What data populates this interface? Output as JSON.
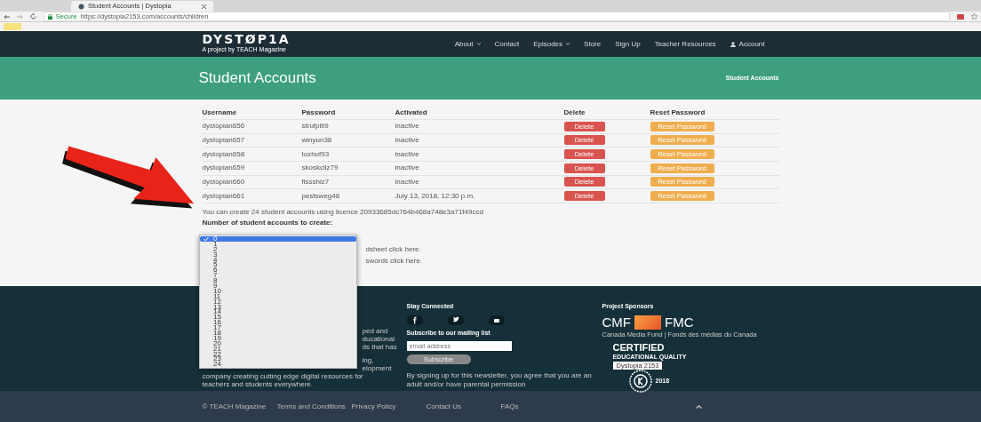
{
  "browser": {
    "tab_title": "Student Accounts | Dystopia",
    "secure_label": "Secure",
    "url": "https://dystopia2153.com/accounts/children"
  },
  "navbar": {
    "logo": "DYSTØP1A",
    "tagline": "A project by TEACH Magazine",
    "items": [
      {
        "label": "About",
        "kind": "dropdown"
      },
      {
        "label": "Contact",
        "kind": "link"
      },
      {
        "label": "Episodes",
        "kind": "dropdown"
      },
      {
        "label": "Store",
        "kind": "link"
      },
      {
        "label": "Sign Up",
        "kind": "link"
      },
      {
        "label": "Teacher Resources",
        "kind": "link"
      },
      {
        "label": "Account",
        "kind": "account"
      }
    ]
  },
  "header": {
    "title": "Student Accounts",
    "breadcrumb": "Student Accounts"
  },
  "table": {
    "columns": [
      "Username",
      "Password",
      "Activated",
      "Delete",
      "Reset Password"
    ],
    "rows": [
      {
        "username": "dystopian656",
        "password": "strufplit9",
        "activated": "inactive",
        "delete": "Delete",
        "reset": "Reset Password"
      },
      {
        "username": "dystopian657",
        "password": "winyun38",
        "activated": "inactive",
        "delete": "Delete",
        "reset": "Reset Password"
      },
      {
        "username": "dystopian658",
        "password": "tozhuf93",
        "activated": "inactive",
        "delete": "Delete",
        "reset": "Reset Password"
      },
      {
        "username": "dystopian659",
        "password": "skoskcliz79",
        "activated": "inactive",
        "delete": "Delete",
        "reset": "Reset Password"
      },
      {
        "username": "dystopian660",
        "password": "fissshiz7",
        "activated": "inactive",
        "delete": "Delete",
        "reset": "Reset Password"
      },
      {
        "username": "dystopian661",
        "password": "pestsweg48",
        "activated": "July 13, 2018, 12:30 p.m.",
        "delete": "Delete",
        "reset": "Reset Password"
      }
    ]
  },
  "licence_text": "You can create 24 student accounts using licence 20933685dc764b468a748e3a71f49ccd",
  "count_label": "Number of student accounts to create:",
  "dropdown_options": [
    {
      "label": "0",
      "selected": true
    },
    {
      "label": "1",
      "selected": false
    },
    {
      "label": "2",
      "selected": false
    },
    {
      "label": "3",
      "selected": false
    },
    {
      "label": "4",
      "selected": false
    },
    {
      "label": "5",
      "selected": false
    },
    {
      "label": "6",
      "selected": false
    },
    {
      "label": "7",
      "selected": false
    },
    {
      "label": "8",
      "selected": false
    },
    {
      "label": "9",
      "selected": false
    },
    {
      "label": "10",
      "selected": false
    },
    {
      "label": "11",
      "selected": false
    },
    {
      "label": "12",
      "selected": false
    },
    {
      "label": "13",
      "selected": false
    },
    {
      "label": "14",
      "selected": false
    },
    {
      "label": "15",
      "selected": false
    },
    {
      "label": "16",
      "selected": false
    },
    {
      "label": "17",
      "selected": false
    },
    {
      "label": "18",
      "selected": false
    },
    {
      "label": "19",
      "selected": false
    },
    {
      "label": "20",
      "selected": false
    },
    {
      "label": "21",
      "selected": false
    },
    {
      "label": "22",
      "selected": false
    },
    {
      "label": "23",
      "selected": false
    },
    {
      "label": "24",
      "selected": false
    }
  ],
  "partial_links": [
    "dsheet click here.",
    "swords click here."
  ],
  "footer": {
    "about_fragments": [
      "ped and",
      "ducational",
      "ds that has",
      "ing,",
      "elopment"
    ],
    "about_lines": [
      "company creating cutting edge digital resources for",
      "teachers and students everywhere."
    ],
    "stay_connected": "Stay Connected",
    "mailing_title": "Subscribe to our mailing list",
    "email_placeholder": "email address",
    "subscribe_button": "Subscribe",
    "newsletter_note": "By signing up for this newsletter, you agree that you are an adult and/or have parental permission",
    "sponsors_title": "Project Sponsors",
    "cmf_left": "CMF",
    "cmf_right": "FMC",
    "cmf_caption": "Canada Media Fund | Fonds des médias du Canada",
    "certified": "CERTIFIED",
    "certified_sub": "EDUCATIONAL QUALITY",
    "certified_name": "Dystopia 2153",
    "certified_year": "2018"
  },
  "bottom_links": [
    "© TEACH Magazine",
    "Terms and Conditions",
    "Privacy Policy",
    "Contact Us",
    "FAQs"
  ]
}
